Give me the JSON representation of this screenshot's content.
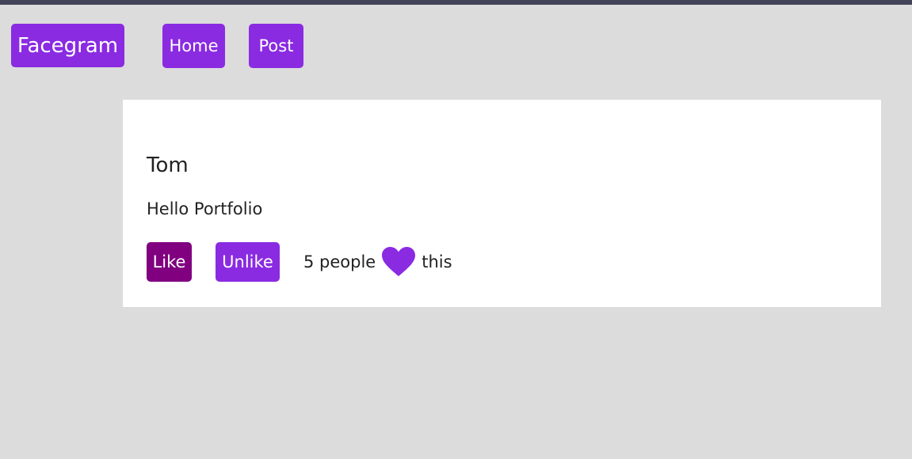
{
  "colors": {
    "accent": "#8a2be2",
    "like_active": "#800080",
    "background": "#dcdcdc",
    "topbar": "#43435a",
    "card": "#ffffff"
  },
  "nav": {
    "brand": "Facegram",
    "home": "Home",
    "post": "Post"
  },
  "post": {
    "author": "Tom",
    "content": "Hello Portfolio",
    "like_label": "Like",
    "unlike_label": "Unlike",
    "likes_count_text": "5 people",
    "likes_suffix": "this",
    "likes_icon": "heart-icon"
  }
}
